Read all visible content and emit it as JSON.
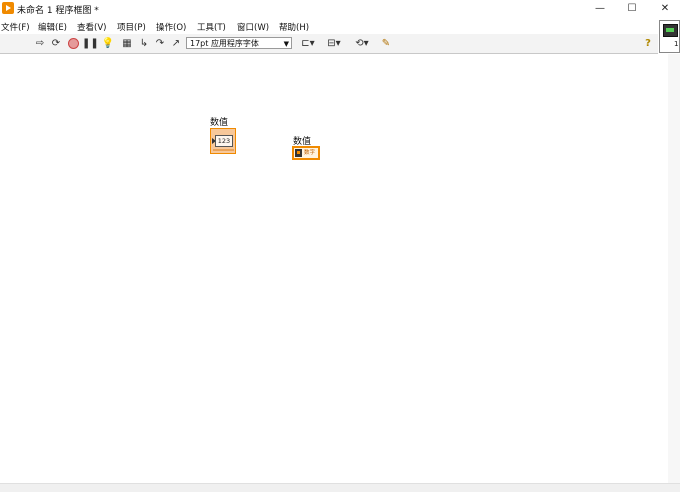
{
  "window": {
    "title": "未命名 1 程序框图 *",
    "controls": {
      "minimize": "—",
      "maximize": "☐",
      "close": "✕"
    }
  },
  "menu": [
    "文件(F)",
    "编辑(E)",
    "查看(V)",
    "项目(P)",
    "操作(O)",
    "工具(T)",
    "窗口(W)",
    "帮助(H)"
  ],
  "toolbar": {
    "font_select": "17pt 应用程序字体",
    "help_glyph": "?",
    "icons": [
      "run-arrow-icon",
      "run-continuous-icon",
      "abort-icon",
      "pause-icon",
      "highlight-execution-icon",
      "retain-wire-values-icon",
      "step-into-icon",
      "step-over-icon",
      "step-out-icon",
      "align-icon",
      "distribute-icon",
      "reorder-icon",
      "cleanup-diagram-icon"
    ]
  },
  "connector_pane": {
    "number": "1"
  },
  "diagram": {
    "terminal": {
      "label": "数值",
      "display": "123"
    },
    "reference": {
      "label": "数值",
      "text": "数字"
    }
  },
  "colors": {
    "accent": "#f08a00",
    "terminal_fill": "#f7c89a"
  }
}
